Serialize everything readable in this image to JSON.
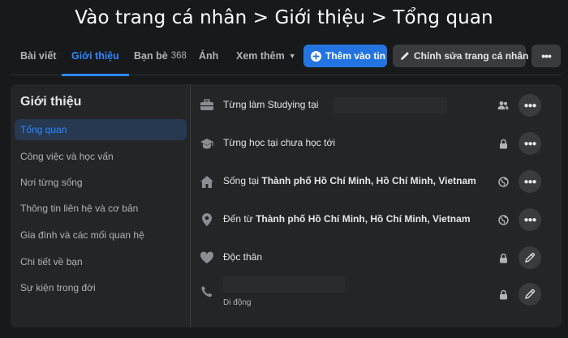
{
  "caption": "Vào trang cá nhân > Giới thiệu > Tổng quan",
  "tabs": [
    {
      "label": "Bài viết"
    },
    {
      "label": "Giới thiệu"
    },
    {
      "label": "Bạn bè",
      "count": "368"
    },
    {
      "label": "Ảnh"
    },
    {
      "label": "Xem thêm"
    }
  ],
  "actions": {
    "add_story": "Thêm vào tin",
    "edit_profile": "Chỉnh sửa trang cá nhân"
  },
  "sidebar": {
    "title": "Giới thiệu",
    "items": [
      {
        "label": "Tổng quan"
      },
      {
        "label": "Công việc và học vấn"
      },
      {
        "label": "Nơi từng sống"
      },
      {
        "label": "Thông tin liên hệ và cơ bản"
      },
      {
        "label": "Gia đình và các mối quan hệ"
      },
      {
        "label": "Chi tiết về bạn"
      },
      {
        "label": "Sự kiện trong đời"
      }
    ]
  },
  "overview": [
    {
      "prefix": "Từng làm Studying tại",
      "bold": "",
      "icon": "briefcase-icon",
      "privacy": "friends-icon"
    },
    {
      "prefix": "Từng học tại chưa học tới",
      "bold": "",
      "icon": "graduation-cap-icon",
      "privacy": "lock-icon"
    },
    {
      "prefix": "Sống tại ",
      "bold": "Thành phố Hồ Chí Minh, Hồ Chí Minh, Vietnam",
      "icon": "home-icon",
      "privacy": "globe-icon"
    },
    {
      "prefix": "Đến từ ",
      "bold": "Thành phố Hồ Chí Minh, Hồ Chí Minh, Vietnam",
      "icon": "location-pin-icon",
      "privacy": "globe-icon"
    },
    {
      "prefix": "Độc thân",
      "bold": "",
      "icon": "heart-icon",
      "privacy": "lock-icon"
    },
    {
      "prefix": "",
      "bold": "",
      "sub": "Di động",
      "icon": "phone-icon",
      "privacy": "lock-icon"
    }
  ],
  "colors": {
    "accent": "#2d88ff",
    "primary_button": "#2374e1",
    "panel": "#242526",
    "background": "#18191a"
  }
}
